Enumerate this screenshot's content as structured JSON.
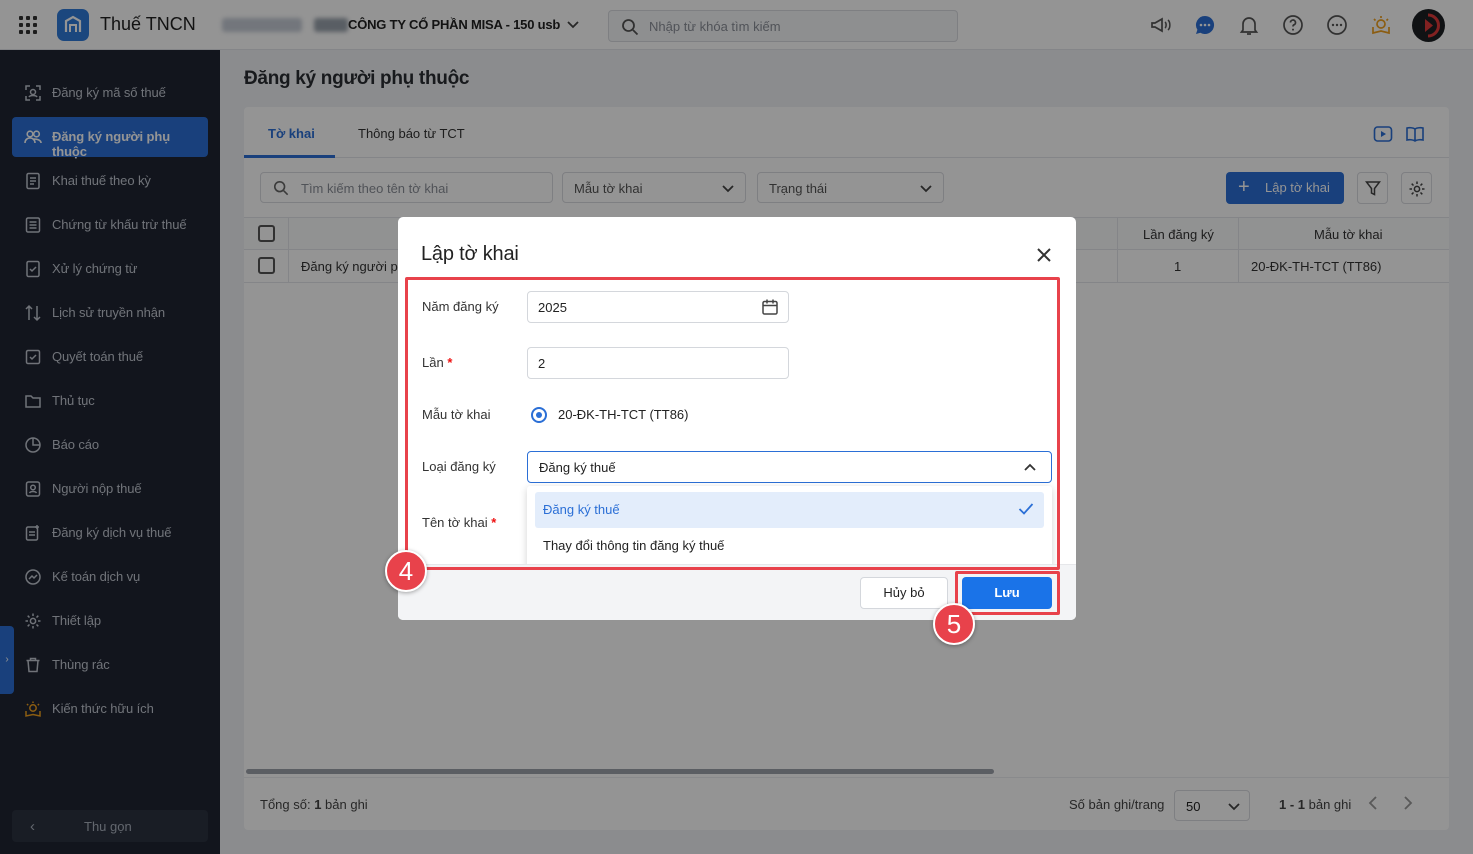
{
  "app": {
    "title": "Thuế TNCN",
    "company": "CÔNG TY CỔ PHẦN MISA - 150 usb",
    "search_placeholder": "Nhập từ khóa tìm kiếm"
  },
  "sidebar": {
    "items": [
      {
        "label": "Đăng ký mã số thuế",
        "icon": "tax-id-icon"
      },
      {
        "label": "Đăng ký người phụ thuộc",
        "icon": "dependents-icon",
        "active": true
      },
      {
        "label": "Khai thuế theo kỳ",
        "icon": "tax-declaration-icon"
      },
      {
        "label": "Chứng từ khấu trừ thuế",
        "icon": "document-icon"
      },
      {
        "label": "Xử lý chứng từ",
        "icon": "process-document-icon"
      },
      {
        "label": "Lịch sử truyền nhận",
        "icon": "transfer-history-icon"
      },
      {
        "label": "Quyết toán thuế",
        "icon": "settlement-icon"
      },
      {
        "label": "Thủ tục",
        "icon": "procedure-icon"
      },
      {
        "label": "Báo cáo",
        "icon": "report-icon"
      },
      {
        "label": "Người nộp thuế",
        "icon": "taxpayer-icon"
      },
      {
        "label": "Đăng ký dịch vụ thuế",
        "icon": "service-icon"
      },
      {
        "label": "Kế toán dịch vụ",
        "icon": "accounting-icon"
      },
      {
        "label": "Thiết lập",
        "icon": "settings-icon"
      },
      {
        "label": "Thùng rác",
        "icon": "trash-icon"
      },
      {
        "label": "Kiến thức hữu ích",
        "icon": "knowledge-icon"
      }
    ],
    "collapse_label": "Thu gọn"
  },
  "page": {
    "title": "Đăng ký người phụ thuộc",
    "tabs": [
      "Tờ khai",
      "Thông báo từ TCT"
    ],
    "filters": {
      "search_placeholder": "Tìm kiếm theo tên tờ khai",
      "form_placeholder": "Mẫu tờ khai",
      "status_placeholder": "Trạng thái"
    },
    "create_button": "Lập tờ khai",
    "table": {
      "headers": [
        "Lần đăng ký",
        "Mẫu tờ khai"
      ],
      "rows": [
        {
          "name": "Đăng ký người ph",
          "times": "1",
          "form": "20-ĐK-TH-TCT (TT86)"
        }
      ]
    },
    "footer": {
      "total_label": "Tổng số: ",
      "total_value": "1",
      "total_suffix": " bản ghi",
      "per_page_label": "Số bản ghi/trang",
      "per_page_value": "50",
      "range": "1 - 1",
      "range_suffix": " bản ghi"
    }
  },
  "dialog": {
    "title": "Lập tờ khai",
    "fields": {
      "year_label": "Năm đăng ký",
      "year_value": "2025",
      "times_label": "Lần",
      "times_value": "2",
      "form_label": "Mẫu tờ khai",
      "form_option": "20-ĐK-TH-TCT (TT86)",
      "type_label": "Loại đăng ký",
      "type_value": "Đăng ký thuế",
      "name_label": "Tên tờ khai"
    },
    "type_options": [
      "Đăng ký thuế",
      "Thay đổi thông tin đăng ký thuế"
    ],
    "cancel_label": "Hủy bỏ",
    "save_label": "Lưu"
  },
  "annotations": {
    "step_form": "4",
    "step_save": "5",
    "color": "#e8424b"
  }
}
